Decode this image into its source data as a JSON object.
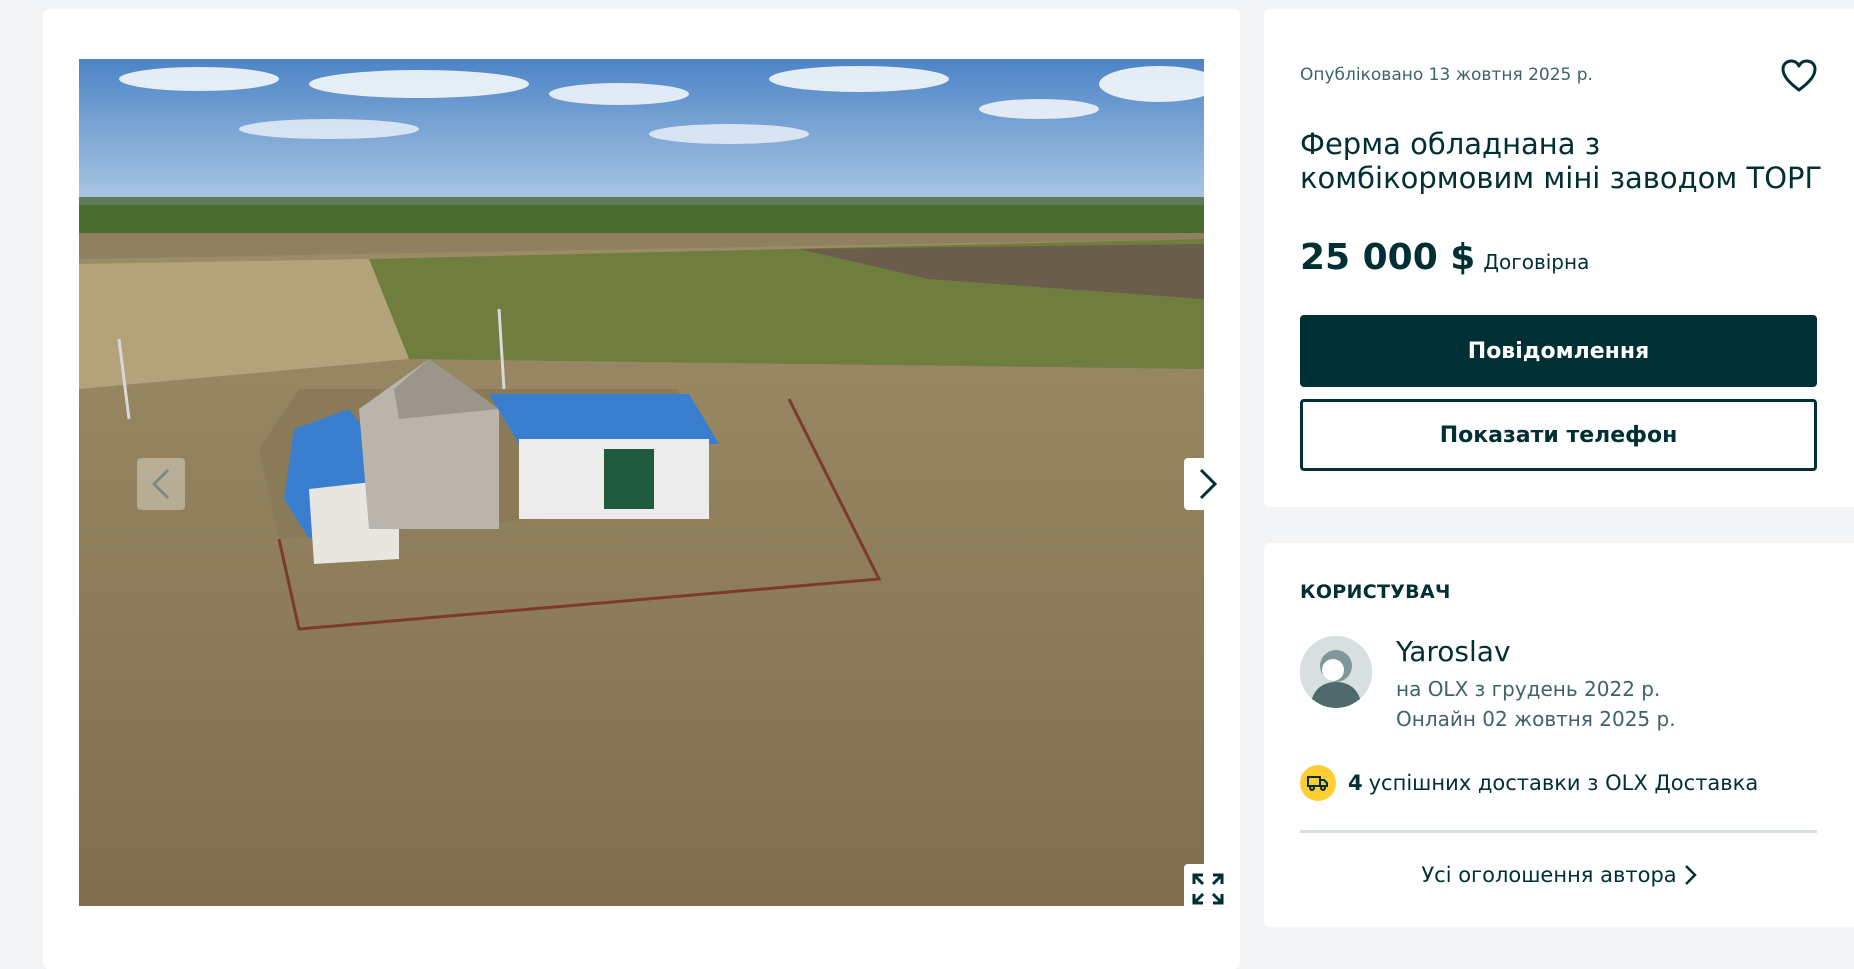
{
  "gallery": {
    "photo_alt": "",
    "prev_icon": "chevron-left-icon",
    "next_icon": "chevron-right-icon",
    "fullscreen_icon": "expand-icon"
  },
  "listing": {
    "published": "Опубліковано 13 жовтня 2025 р.",
    "title": "Ферма обладнана з комбікормовим міні заводом ТОРГ",
    "price": "25 000 $",
    "negotiable": "Договірна",
    "message_button": "Повідомлення",
    "phone_button": "Показати телефон",
    "favorite_icon": "heart-icon"
  },
  "user": {
    "heading": "КОРИСТУВАЧ",
    "name": "Yaroslav",
    "since": "на OLX з грудень 2022 р.",
    "online": "Онлайн 02 жовтня 2025 р.",
    "delivery_count": "4",
    "delivery_text": "успішних доставки з OLX Доставка",
    "all_ads_link": "Усі оголошення автора"
  },
  "colors": {
    "primary": "#002f34",
    "accent_yellow": "#ffce32",
    "page_bg": "#f2f4f5",
    "muted_text": "#406367"
  }
}
